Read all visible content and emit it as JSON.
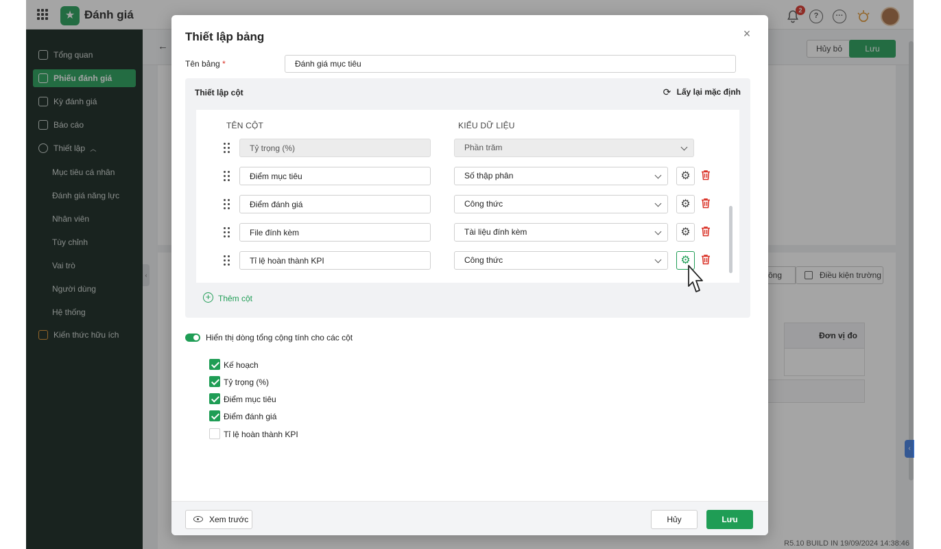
{
  "app": {
    "name": "Đánh giá",
    "notification_count": "2",
    "build_info": "R5.10 BUILD IN 19/09/2024 14:38:46"
  },
  "sidebar": {
    "items": [
      {
        "label": "Tổng quan",
        "icon": "chart-icon"
      },
      {
        "label": "Phiếu đánh giá",
        "icon": "layers-icon",
        "active": true
      },
      {
        "label": "Kỳ đánh giá",
        "icon": "calendar-icon"
      },
      {
        "label": "Báo cáo",
        "icon": "report-icon"
      },
      {
        "label": "Thiết lập",
        "icon": "gear-icon",
        "expanded": true
      }
    ],
    "subitems": [
      "Mục tiêu cá nhân",
      "Đánh giá năng lực",
      "Nhân viên",
      "Tùy chỉnh",
      "Vai trò",
      "Người dùng",
      "Hệ thống"
    ],
    "knowledge": "Kiến thức hữu ích"
  },
  "page_header": {
    "cancel_label": "Hủy bỏ",
    "save_label": "Lưu"
  },
  "background": {
    "partial_button_label": "ông",
    "condition_button_label": "Điều kiện trường",
    "table_header_unit": "Đơn vị đo"
  },
  "dialog": {
    "title": "Thiết lập bảng",
    "table_name_label": "Tên bảng",
    "table_name_required": "*",
    "table_name_value": "Đánh giá mục tiêu",
    "columns_section": {
      "title": "Thiết lập cột",
      "reset_label": "Lấy lại mặc định",
      "header_name": "TÊN CỘT",
      "header_type": "KIỂU DỮ LIỆU",
      "rows": [
        {
          "name": "Tỷ trọng (%)",
          "type": "Phần trăm",
          "locked": true
        },
        {
          "name": "Điểm mục tiêu",
          "type": "Số thập phân"
        },
        {
          "name": "Điểm đánh giá",
          "type": "Công thức"
        },
        {
          "name": "File đính kèm",
          "type": "Tài liệu đính kèm"
        },
        {
          "name": "Tỉ lệ hoàn thành KPI",
          "type": "Công thức",
          "highlighted": true
        }
      ],
      "add_column_label": "Thêm cột"
    },
    "show_totals_label": "Hiển thị dòng tổng cộng tính cho các cột",
    "show_totals_on": true,
    "total_columns": [
      {
        "label": "Kế hoạch",
        "checked": true
      },
      {
        "label": "Tỷ trọng (%)",
        "checked": true
      },
      {
        "label": "Điểm mục tiêu",
        "checked": true
      },
      {
        "label": "Điểm đánh giá",
        "checked": true
      },
      {
        "label": "Tỉ lệ hoàn thành KPI",
        "checked": false
      }
    ],
    "footer": {
      "preview_label": "Xem trước",
      "cancel_label": "Hủy",
      "save_label": "Lưu"
    }
  },
  "colors": {
    "brand_green": "#1f9d55",
    "sidebar_bg": "#0f1f19",
    "danger_red": "#d93025"
  }
}
